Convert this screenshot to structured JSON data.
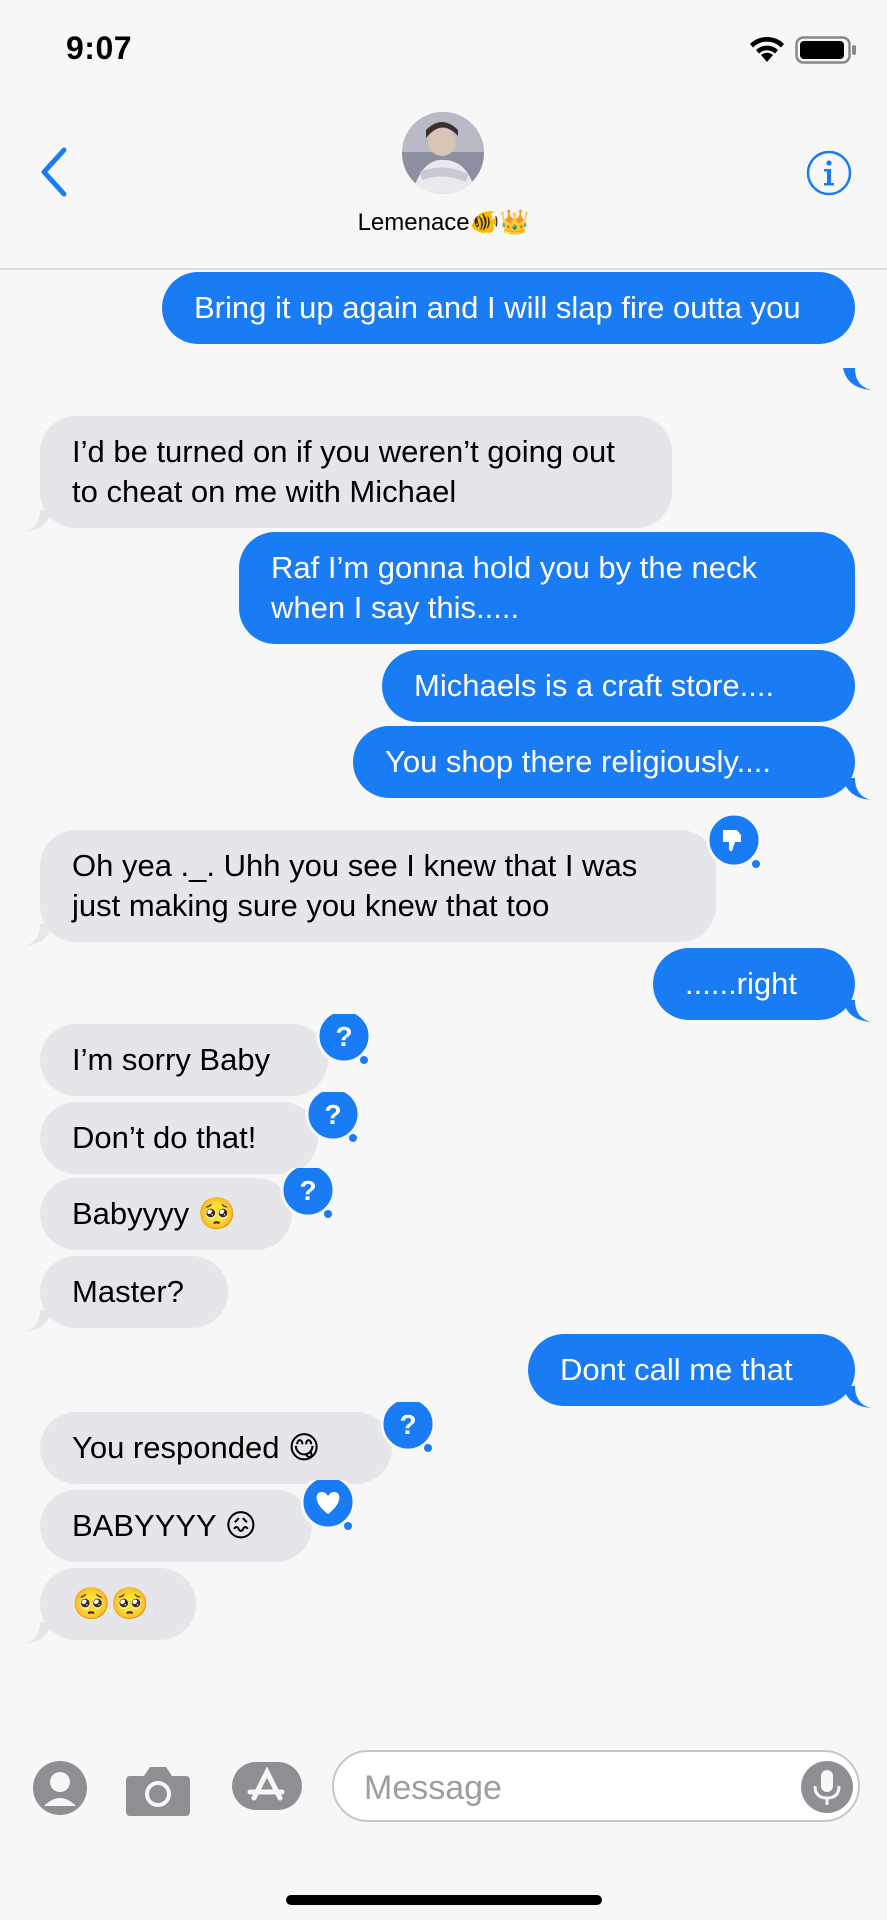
{
  "status_bar": {
    "time": "9:07"
  },
  "header": {
    "contact_name": "Lemenace",
    "contact_emoji": "🐠👑"
  },
  "messages": [
    {
      "dir": "out",
      "text": "Bring it up again and I will slap fire outta you"
    },
    {
      "dir": "in",
      "text": "I’d be turned on if you weren’t going out to cheat on me with Michael"
    },
    {
      "dir": "out",
      "text": "Raf I’m gonna hold you by the neck when I say this....."
    },
    {
      "dir": "out",
      "text": "Michaels is a craft store...."
    },
    {
      "dir": "out",
      "text": "You shop there religiously...."
    },
    {
      "dir": "in",
      "text": "Oh yea ._. Uhh you see I knew that I was just making sure you knew that too",
      "tapback": "thumbs-down"
    },
    {
      "dir": "out",
      "text": "......right"
    },
    {
      "dir": "in",
      "text": "I’m sorry Baby",
      "tapback": "question"
    },
    {
      "dir": "in",
      "text": "Don’t do that!",
      "tapback": "question"
    },
    {
      "dir": "in",
      "text": "Babyyyy 🥺",
      "tapback": "question"
    },
    {
      "dir": "in",
      "text": "Master?"
    },
    {
      "dir": "out",
      "text": "Dont call me that"
    },
    {
      "dir": "in",
      "text": "You responded 😋",
      "tapback": "question"
    },
    {
      "dir": "in",
      "text": "BABYYYY 😖",
      "tapback": "heart"
    },
    {
      "dir": "in",
      "text": "🥺🥺"
    }
  ],
  "composer": {
    "placeholder": "Message"
  },
  "colors": {
    "accent": "#1a7cf5",
    "incoming": "#e6e5ea"
  }
}
